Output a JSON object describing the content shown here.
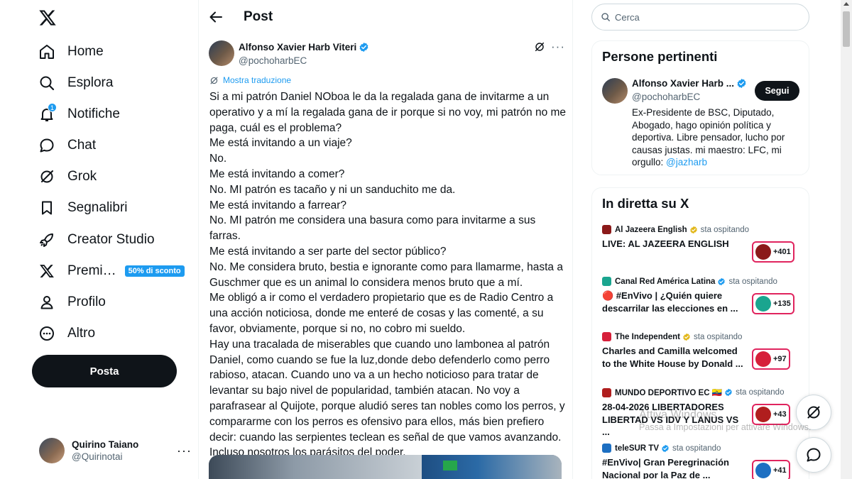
{
  "nav": {
    "items": [
      {
        "label": "Home",
        "icon": "home-icon"
      },
      {
        "label": "Esplora",
        "icon": "search-icon"
      },
      {
        "label": "Notifiche",
        "icon": "bell-icon",
        "badge": "1"
      },
      {
        "label": "Chat",
        "icon": "chat-icon"
      },
      {
        "label": "Grok",
        "icon": "grok-icon"
      },
      {
        "label": "Segnalibri",
        "icon": "bookmark-icon"
      },
      {
        "label": "Creator Studio",
        "icon": "rocket-icon"
      },
      {
        "label": "Premi…",
        "icon": "x-icon",
        "promo": "50% di sconto"
      },
      {
        "label": "Profilo",
        "icon": "person-icon"
      },
      {
        "label": "Altro",
        "icon": "more-circle-icon"
      }
    ],
    "post_button": "Posta",
    "account": {
      "name": "Quirino Taiano",
      "handle": "@Quirinotai",
      "more": "···"
    }
  },
  "main": {
    "title": "Post",
    "post": {
      "author_name": "Alfonso Xavier Harb Viteri",
      "author_handle": "@pochoharbEC",
      "more": "···",
      "translate_label": "Mostra traduzione",
      "lines": [
        "Si a mi patrón Daniel NOboa le da la regalada gana de invitarme a un",
        "operativo y a mí la regalada gana de ir porque si no voy, mi patrón no me",
        "paga, cuál es el problema?",
        "Me está invitando a un viaje?",
        "No.",
        "Me está invitando a comer?",
        "No. MI patrón es tacaño y ni un sanduchito me da.",
        "Me está invitando a farrear?",
        "No. MI patrón me considera una basura como para invitarme a sus",
        "farras.",
        "Me está invitando a ser parte del sector público?",
        "No. Me considera bruto, bestia e ignorante como para llamarme, hasta a",
        "Guschmer que es un animal lo considera menos bruto que a mí.",
        "Me obligó a ir como el verdadero propietario que es de Radio Centro a",
        "una acción noticiosa, donde me enteré de cosas y las comenté, a su",
        "favor, obviamente, porque si no, no cobro mi sueldo.",
        "Hay una tracalada de miserables que cuando uno lambonea al patrón",
        "Daniel, como cuando se fue la luz,donde debo defenderlo como perro",
        "rabioso,  atacan. Cuando uno va a un hecho noticioso para tratar de",
        "levantar su bajo nivel de popularidad, también atacan. No voy a",
        "parafrasear al Quijote, porque aludió seres tan nobles como los perros, y",
        "compararme con los perros es ofensivo para ellos, más bien prefiero",
        "decir: cuando las serpientes teclean es señal de que vamos avanzando.",
        "Incluso nosotros los parásitos del poder."
      ]
    }
  },
  "sidebar": {
    "search_placeholder": "Cerca",
    "relevant": {
      "title": "Persone pertinenti",
      "name": "Alfonso Xavier Harb ...",
      "handle": "@pochoharbEC",
      "follow_label": "Segui",
      "bio": "Ex-Presidente de BSC, Diputado, Abogado, hago opinión política y deportiva. Libre pensador, lucho por causas justas. mi maestro: LFC, mi orgullo: ",
      "bio_mention": "@jazharb"
    },
    "live": {
      "title": "In diretta su X",
      "items": [
        {
          "source": "Al Jazeera English",
          "hosting": "sta ospitando",
          "text": "LIVE: AL JAZEERA ENGLISH",
          "count": "+401",
          "logo_color": "#8b1a1a",
          "verified_color": "#e2b719"
        },
        {
          "source": "Canal Red América Latina",
          "hosting": "sta ospitando",
          "text": "🔴 #EnVivo | ¿Quién quiere descarrilar las elecciones en ...",
          "count": "+135",
          "logo_color": "#1aa58f",
          "verified_color": "#1d9bf0"
        },
        {
          "source": "The Independent",
          "hosting": "sta ospitando",
          "text": "Charles and Camilla welcomed to the White House by Donald ...",
          "count": "+97",
          "logo_color": "#d6203a",
          "verified_color": "#e2b719"
        },
        {
          "source": "MUNDO DEPORTIVO EC 🇪🇨",
          "hosting": "sta ospitando",
          "text": "28-04-2026 LIBERTADORES LIBERTAD VS IDV Y LANUS VS ...",
          "count": "+43",
          "logo_color": "#b01e1e",
          "verified_color": "#1d9bf0"
        },
        {
          "source": "teleSUR TV",
          "hosting": "sta ospitando",
          "text": "#EnVivo| Gran Peregrinación Nacional por la Paz de ...",
          "count": "+41",
          "logo_color": "#1d6fc2",
          "verified_color": "#1d9bf0"
        }
      ]
    }
  },
  "watermark": {
    "line1": "Attiva Windows",
    "line2": "Passa a Impostazioni per attivare Windows."
  },
  "colors": {
    "accent": "#1d9bf0",
    "text": "#0f1419",
    "muted": "#536471",
    "live_border": "#e0245e",
    "gold_check": "#e2b719"
  }
}
